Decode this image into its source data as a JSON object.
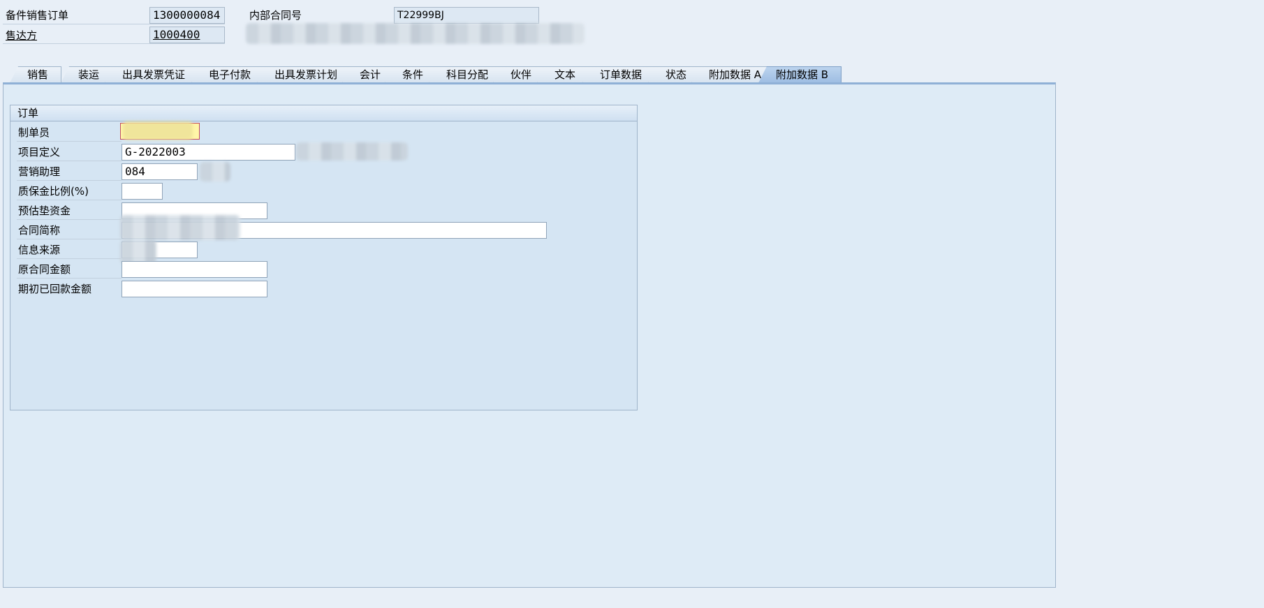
{
  "header": {
    "order_label": "备件销售订单",
    "order_number": "1300000084",
    "internal_contract_label": "内部合同号",
    "internal_contract_value": "T22999BJ",
    "sold_to_label": "售达方",
    "sold_to_value": "1000400"
  },
  "tabs": [
    {
      "label": "销售"
    },
    {
      "label": "装运"
    },
    {
      "label": "出具发票凭证"
    },
    {
      "label": "电子付款"
    },
    {
      "label": "出具发票计划"
    },
    {
      "label": "会计"
    },
    {
      "label": "条件"
    },
    {
      "label": "科目分配"
    },
    {
      "label": "伙伴"
    },
    {
      "label": "文本"
    },
    {
      "label": "订单数据"
    },
    {
      "label": "状态"
    },
    {
      "label": "附加数据 A"
    },
    {
      "label": "附加数据 B"
    }
  ],
  "active_tab": "附加数据 B",
  "group": {
    "title": "订单",
    "fields": [
      {
        "label": "制单员",
        "value": ""
      },
      {
        "label": "项目定义",
        "value": "G-2022003"
      },
      {
        "label": "营销助理",
        "value": "084"
      },
      {
        "label": "质保金比例(%)",
        "value": ""
      },
      {
        "label": "预估垫资金",
        "value": ""
      },
      {
        "label": "合同简称",
        "value": ""
      },
      {
        "label": "信息来源",
        "value": ""
      },
      {
        "label": "原合同金额",
        "value": ""
      },
      {
        "label": "期初已回款金额",
        "value": ""
      }
    ]
  }
}
